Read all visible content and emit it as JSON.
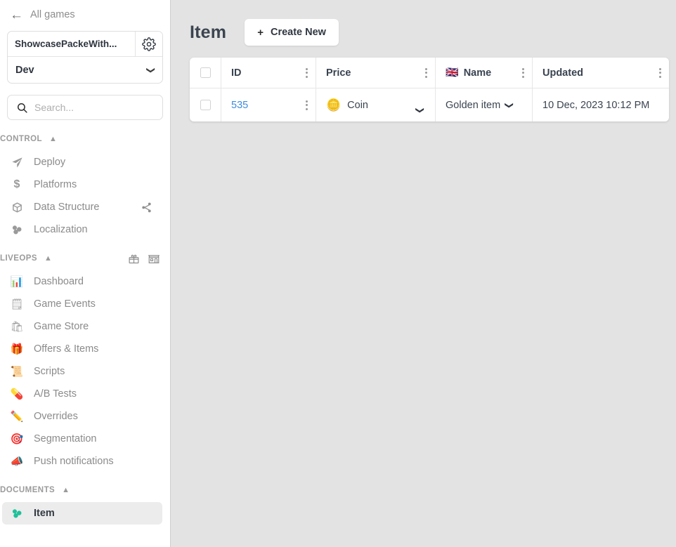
{
  "sidebar": {
    "back_link": {
      "label": "All games",
      "icon": "back-arrow-icon"
    },
    "game_selector": {
      "game_name": "ShowcasePackeWith...",
      "settings_icon": "gear-icon",
      "environment": "Dev",
      "environment_caret": "chevron-down-icon"
    },
    "search": {
      "placeholder": "Search...",
      "value": "",
      "icon": "search-icon"
    },
    "sections": [
      {
        "title": "CONTROL",
        "caret": "chevron-up-icon",
        "actions": [],
        "items": [
          {
            "label": "Deploy",
            "icon": "paper-plane-icon",
            "glyph": "➤",
            "selected": false,
            "extra": ""
          },
          {
            "label": "Platforms",
            "icon": "dollar-icon",
            "glyph": "$",
            "selected": false,
            "extra": ""
          },
          {
            "label": "Data Structure",
            "icon": "box-icon",
            "glyph": "⬡",
            "selected": false,
            "extra": "share-icon"
          },
          {
            "label": "Localization",
            "icon": "molecule-icon",
            "glyph": "",
            "selected": false,
            "extra": ""
          }
        ]
      },
      {
        "title": "LIVEOPS",
        "caret": "chevron-up-icon",
        "actions": [
          "gift-icon",
          "store-icon"
        ],
        "items": [
          {
            "label": "Dashboard",
            "icon": "bar-chart-emoji",
            "glyph": "📊",
            "selected": false,
            "extra": ""
          },
          {
            "label": "Game Events",
            "icon": "notepad-emoji",
            "glyph": "🗒",
            "selected": false,
            "extra": ""
          },
          {
            "label": "Game Store",
            "icon": "shopping-bags-emoji",
            "glyph": "🛍",
            "selected": false,
            "extra": ""
          },
          {
            "label": "Offers & Items",
            "icon": "gift-emoji",
            "glyph": "🎁",
            "selected": false,
            "extra": ""
          },
          {
            "label": "Scripts",
            "icon": "scroll-emoji",
            "glyph": "📜",
            "selected": false,
            "extra": ""
          },
          {
            "label": "A/B Tests",
            "icon": "pill-emoji",
            "glyph": "💊",
            "selected": false,
            "extra": ""
          },
          {
            "label": "Overrides",
            "icon": "pencil-emoji",
            "glyph": "✏️",
            "selected": false,
            "extra": ""
          },
          {
            "label": "Segmentation",
            "icon": "dart-emoji",
            "glyph": "🎯",
            "selected": false,
            "extra": ""
          },
          {
            "label": "Push notifications",
            "icon": "megaphone-emoji",
            "glyph": "📣",
            "selected": false,
            "extra": ""
          }
        ]
      },
      {
        "title": "DOCUMENTS",
        "caret": "chevron-up-icon",
        "actions": [],
        "items": [
          {
            "label": "Item",
            "icon": "molecule-icon-teal",
            "glyph": "",
            "selected": true,
            "extra": ""
          }
        ]
      }
    ]
  },
  "main": {
    "page_title": "Item",
    "create_button": {
      "label": "Create New",
      "plus": "+",
      "icon": "plus-icon"
    },
    "table": {
      "select_all_checkbox": false,
      "columns": [
        {
          "key": "check",
          "label": "",
          "menu": false
        },
        {
          "key": "id",
          "label": "ID",
          "menu": true,
          "flag": ""
        },
        {
          "key": "price",
          "label": "Price",
          "menu": true,
          "flag": ""
        },
        {
          "key": "name",
          "label": "Name",
          "menu": true,
          "flag": "🇬🇧"
        },
        {
          "key": "updated",
          "label": "Updated",
          "menu": true,
          "flag": ""
        }
      ],
      "rows": [
        {
          "selected": false,
          "id": "535",
          "price": {
            "icon": "coin-emoji",
            "glyph": "🪙",
            "label": "Coin",
            "caret": "chevron-down-icon"
          },
          "name": {
            "label": "Golden item",
            "caret": "chevron-down-icon"
          },
          "updated": "10 Dec, 2023 10:12 PM"
        }
      ]
    }
  },
  "colors": {
    "accent_link": "#3f8bdb",
    "page_bg": "#e3e3e3",
    "sidebar_bg": "#ffffff",
    "selected_item_bg": "#ececec",
    "teal_icon": "#1fc19a",
    "muted_text": "#8b8b8b",
    "heading_text": "#394350"
  }
}
